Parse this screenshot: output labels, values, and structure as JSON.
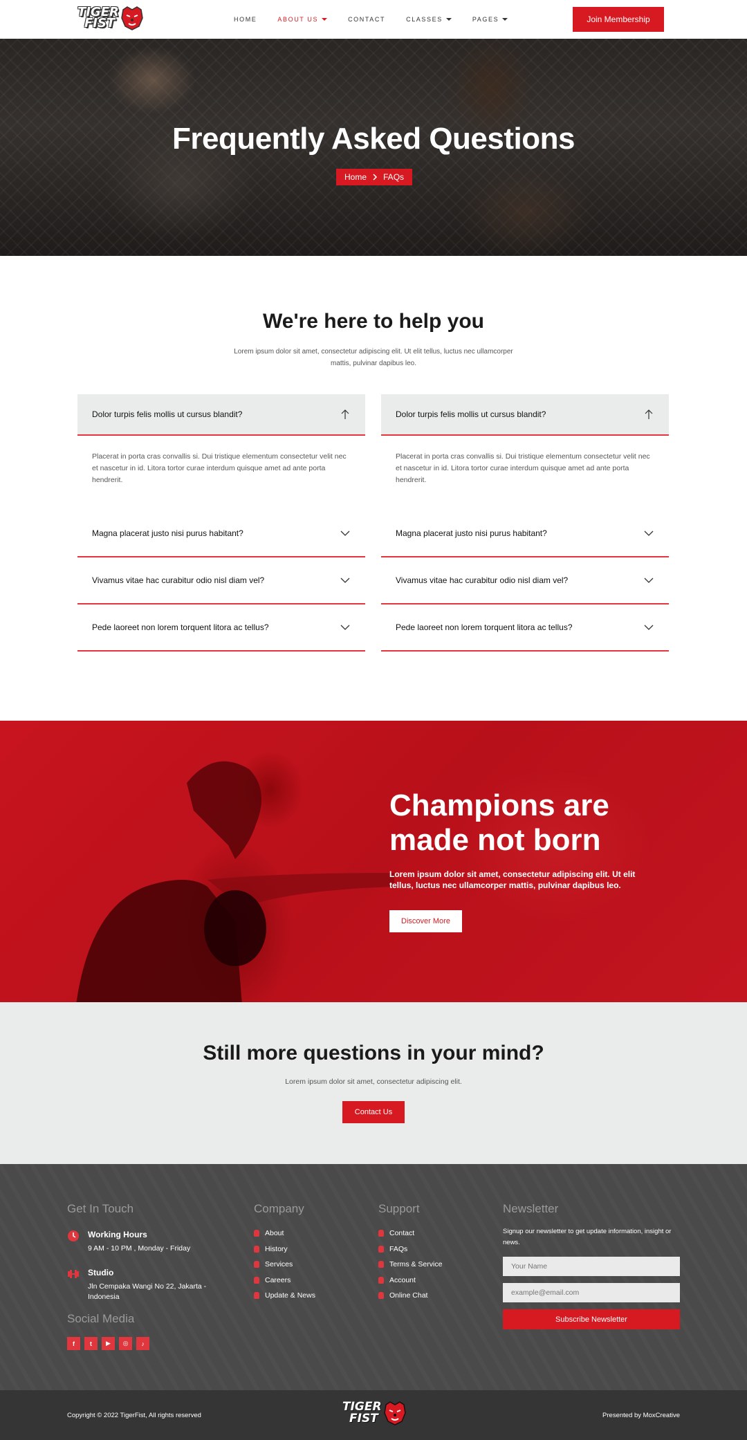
{
  "header": {
    "logo": {
      "line1": "TIGER",
      "line2": "FIST"
    },
    "nav": [
      {
        "label": "HOME",
        "active": false,
        "dropdown": false
      },
      {
        "label": "ABOUT US",
        "active": true,
        "dropdown": true
      },
      {
        "label": "CONTACT",
        "active": false,
        "dropdown": false
      },
      {
        "label": "CLASSES",
        "active": false,
        "dropdown": true
      },
      {
        "label": "PAGES",
        "active": false,
        "dropdown": true
      }
    ],
    "join_label": "Join Membership"
  },
  "hero": {
    "title": "Frequently Asked Questions",
    "breadcrumb_home": "Home",
    "breadcrumb_current": "FAQs"
  },
  "help": {
    "title": "We're here to help you",
    "subtitle": "Lorem ipsum dolor sit amet, consectetur adipiscing elit. Ut elit tellus, luctus nec ullamcorper mattis, pulvinar dapibus leo."
  },
  "faq_left": {
    "open_q": "Dolor turpis felis mollis ut cursus blandit?",
    "open_a": "Placerat in porta cras convallis si. Dui tristique elementum consectetur velit nec et nascetur in id. Litora tortor curae interdum quisque amet ad ante porta hendrerit.",
    "q2": "Magna placerat justo nisi purus habitant?",
    "q3": "Vivamus vitae hac curabitur odio nisl diam vel?",
    "q4": "Pede laoreet non lorem torquent litora ac tellus?"
  },
  "faq_right": {
    "open_q": "Dolor turpis felis mollis ut cursus blandit?",
    "open_a": "Placerat in porta cras convallis si. Dui tristique elementum consectetur velit nec et nascetur in id. Litora tortor curae interdum quisque amet ad ante porta hendrerit.",
    "q2": "Magna placerat justo nisi purus habitant?",
    "q3": "Vivamus vitae hac curabitur odio nisl diam vel?",
    "q4": "Pede laoreet non lorem torquent litora ac tellus?"
  },
  "champ": {
    "title_line1": "Champions are",
    "title_line2": "made not born",
    "text": "Lorem ipsum dolor sit amet, consectetur adipiscing elit. Ut elit tellus, luctus nec ullamcorper mattis, pulvinar dapibus leo.",
    "button": "Discover More"
  },
  "still": {
    "title": "Still more questions in your mind?",
    "text": "Lorem ipsum dolor sit amet, consectetur adipiscing elit.",
    "button": "Contact Us"
  },
  "footer": {
    "touch": {
      "heading": "Get In Touch",
      "hours_title": "Working Hours",
      "hours_text": "9 AM - 10 PM , Monday - Friday",
      "studio_title": "Studio",
      "studio_text": "Jln Cempaka Wangi No 22, Jakarta - Indonesia",
      "social_heading": "Social Media"
    },
    "socials": [
      "facebook-icon",
      "twitter-icon",
      "youtube-icon",
      "instagram-icon",
      "tiktok-icon"
    ],
    "company": {
      "heading": "Company",
      "links": [
        "About",
        "History",
        "Services",
        "Careers",
        "Update & News"
      ]
    },
    "support": {
      "heading": "Support",
      "links": [
        "Contact",
        "FAQs",
        "Terms & Service",
        "Account",
        "Online Chat"
      ]
    },
    "newsletter": {
      "heading": "Newsletter",
      "text": "Signup our newsletter to get update information, insight or news.",
      "name_placeholder": "Your Name",
      "email_placeholder": "example@email.com",
      "button": "Subscribe Newsletter"
    },
    "copyright": "Copyright © 2022 TigerFist, All rights reserved",
    "presented": "Presented by MoxCreative"
  },
  "colors": {
    "accent": "#d71a21",
    "footer_bg": "#4a4a4a",
    "light_bg": "#eaeceb"
  }
}
